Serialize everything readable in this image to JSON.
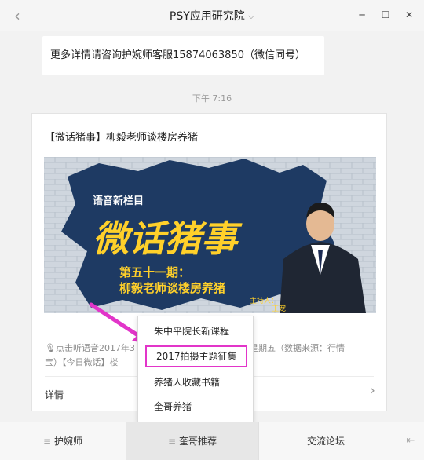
{
  "window": {
    "title": "PSY应用研究院",
    "chevron": "⌵",
    "back_icon": "‹",
    "minimize": "─",
    "maximize": "☐",
    "close": "✕"
  },
  "chat": {
    "message": "更多详情请咨询护婉师客服15874063850（微信同号）",
    "timestamp": "下午 7:16"
  },
  "card": {
    "title": "【微话猪事】柳毅老师谈楼房养猪",
    "banner": {
      "small_tag": "语音新栏目",
      "big_title": "微话猪事",
      "episode": "第五十一期：",
      "topic": "柳毅老师谈楼房养猪",
      "host_label": "主持人：",
      "host_name": "王宠"
    },
    "desc_line1": "🎙点击听语音2017年3",
    "desc_line1_end": "星期五（数据来源：行情",
    "desc_line2": "宝）【今日微话】楼",
    "detail_label": "详情",
    "detail_chevron": "›"
  },
  "popup": {
    "items": [
      {
        "label": "朱中平院长新课程"
      },
      {
        "label": "2017拍摄主题征集"
      },
      {
        "label": "养猪人收藏书籍"
      },
      {
        "label": "奎哥养猪"
      }
    ]
  },
  "bottom_nav": {
    "tabs": [
      {
        "label": "护婉师"
      },
      {
        "label": "奎哥推荐"
      },
      {
        "label": "交流论坛"
      }
    ],
    "menu_glyph": "≡",
    "toggle_icon": "⇤"
  },
  "colors": {
    "highlight": "#e235c9",
    "banner_title": "#ffd02a"
  }
}
